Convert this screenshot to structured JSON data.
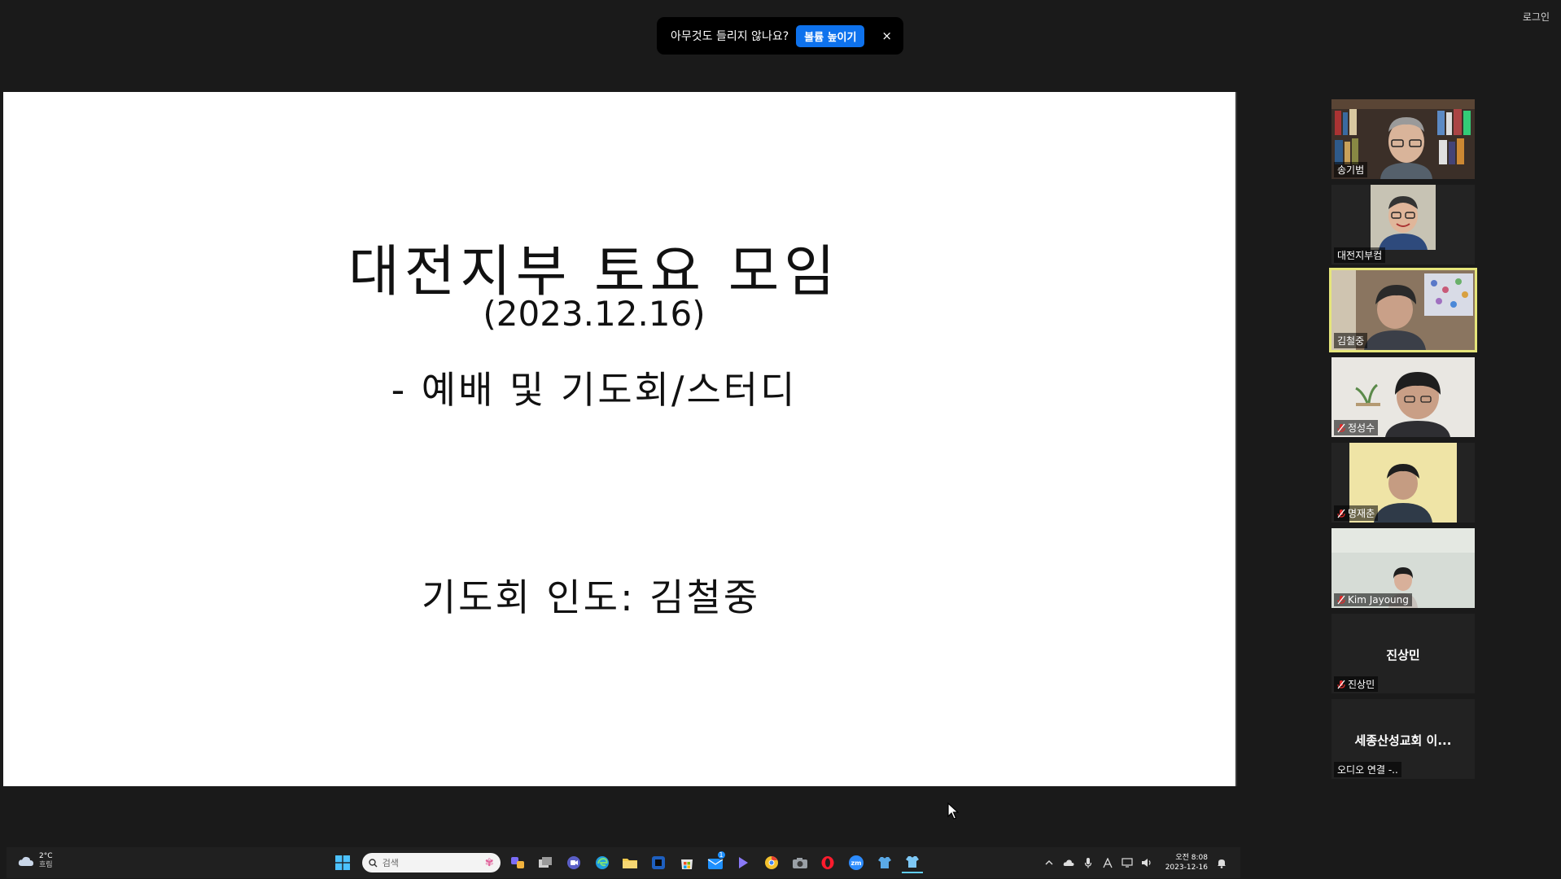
{
  "window": {
    "login_label": "로그인"
  },
  "toast": {
    "message": "아무것도 들리지 않나요?",
    "button_label": "볼륨 높이기",
    "close_glyph": "×"
  },
  "slide": {
    "title": "대전지부 토요 모임",
    "date": "(2023.12.16)",
    "subtitle": "- 예배 및 기도회/스터디",
    "leader": "기도회 인도: 김철중"
  },
  "taskbar": {
    "weather_temp": "2°C",
    "weather_desc": "흐림",
    "search_placeholder": "검색",
    "clock_time": "오전 8:08",
    "clock_date": "2023-12-16",
    "notification_count": "1",
    "zoom_label": "zm"
  },
  "participants": [
    {
      "name": "송기범",
      "muted": false,
      "video": true
    },
    {
      "name": "대전지부컴",
      "muted": false,
      "video": true
    },
    {
      "name": "김철중",
      "muted": false,
      "video": true,
      "active_speaker": true
    },
    {
      "name": "정성수",
      "muted": true,
      "video": true
    },
    {
      "name": "명재춘",
      "muted": true,
      "video": true
    },
    {
      "name": "Kim Jayoung",
      "muted": true,
      "video": true
    },
    {
      "name": "진상민",
      "display_name": "진상민",
      "muted": true,
      "video": false
    },
    {
      "name": "오디오 연결 -..",
      "display_name": "세종산성교회 이...",
      "muted": false,
      "video": false
    }
  ],
  "colors": {
    "zoom_blue": "#0e72ed",
    "active_speaker": "#e6e67a",
    "mute_red": "#e02828"
  }
}
